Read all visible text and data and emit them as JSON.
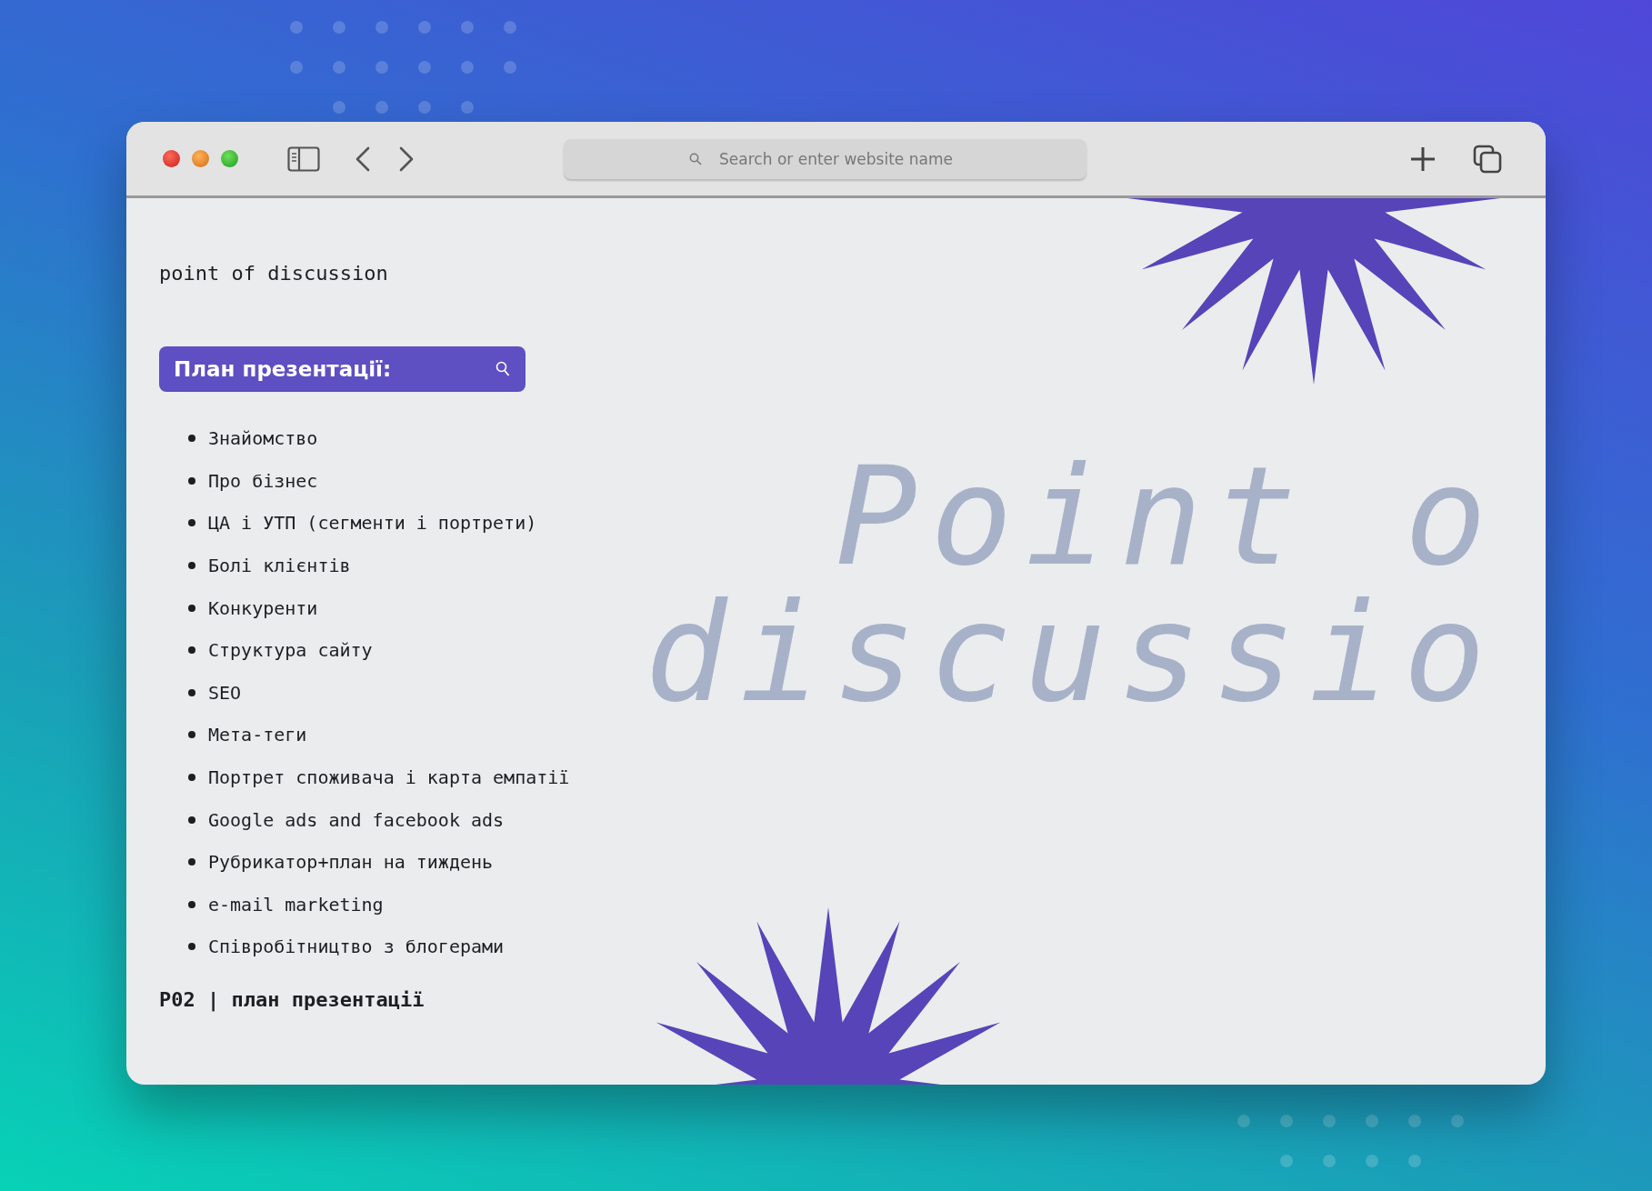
{
  "browser": {
    "address_bar": {
      "placeholder": "Search or enter website name"
    }
  },
  "slide": {
    "subtitle": "point of discussion",
    "header": {
      "label": "План презентації:"
    },
    "items": [
      "Знайомство",
      "Про бізнес",
      "ЦА і УТП (сегменти і портрети)",
      "Болі клієнтів",
      "Конкуренти",
      "Структура сайту",
      "SEO",
      "Мета-теги",
      "Портрет споживача і карта емпатії",
      "Google ads and facebook ads",
      "Рубрикатор+план на тиждень",
      "e-mail marketing",
      "Співробітництво з блогерами"
    ],
    "watermark_lines": [
      "Point o",
      "discussio"
    ],
    "footer": "P02 | план презентації"
  }
}
